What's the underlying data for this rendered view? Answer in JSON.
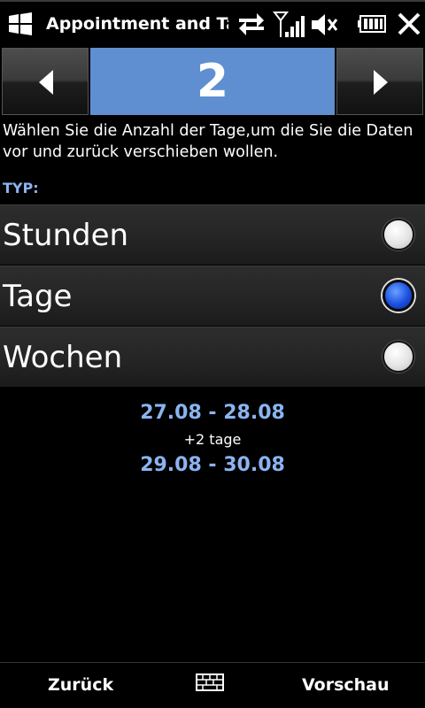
{
  "titlebar": {
    "title": "Appointment and Ta",
    "icons": [
      "windows-start-icon",
      "data-sync-icon",
      "signal-strength-icon",
      "speaker-muted-icon",
      "battery-icon",
      "close-icon"
    ]
  },
  "stepper": {
    "value": "2",
    "prev_icon": "chevron-left-icon",
    "next_icon": "chevron-right-icon"
  },
  "instruction": "Wählen Sie die Anzahl der Tage,um die Sie die Daten vor und zurück verschieben wollen.",
  "type_section": {
    "label": "TYP:",
    "options": [
      {
        "label": "Stunden",
        "selected": false
      },
      {
        "label": "Tage",
        "selected": true
      },
      {
        "label": "Wochen",
        "selected": false
      }
    ]
  },
  "preview": {
    "from_range": "27.08 - 28.08",
    "delta": "+2 tage",
    "to_range": "29.08 - 30.08"
  },
  "softkeys": {
    "left": "Zurück",
    "center_icon": "keyboard-icon",
    "right": "Vorschau"
  },
  "colors": {
    "accent": "#5f8fd0",
    "highlight_text": "#8ab4f0",
    "radio_selected": "#1a4fe0"
  }
}
